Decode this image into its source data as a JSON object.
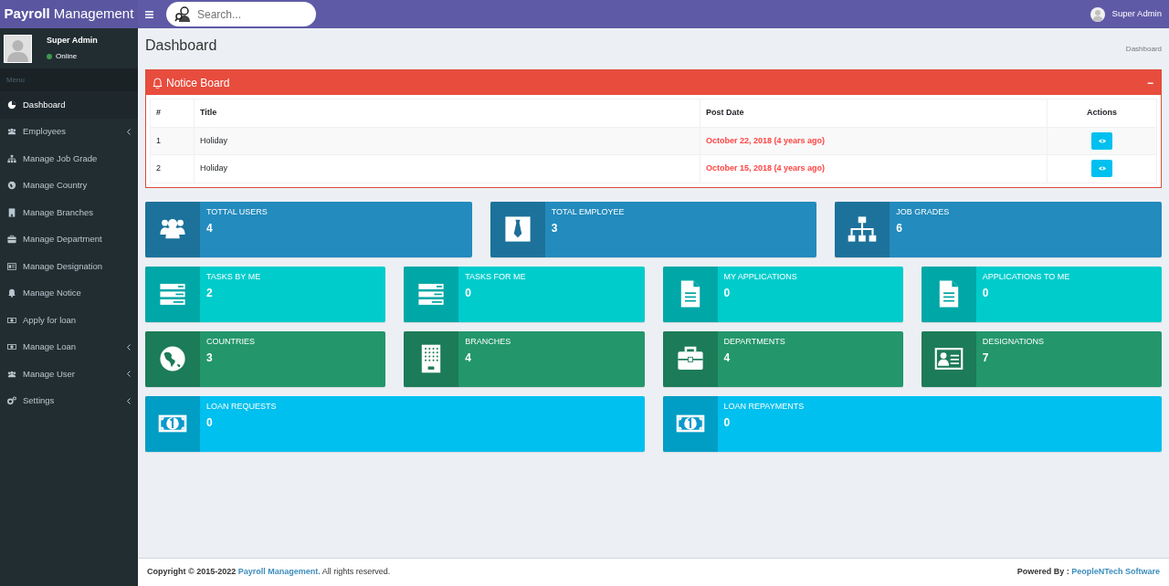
{
  "navbar": {
    "brand_bold": "Payroll",
    "brand_rest": "Management",
    "search": {
      "placeholder": "Search..."
    },
    "user": "Super Admin"
  },
  "sidebar": {
    "user": {
      "name": "Super Admin",
      "status": "Online"
    },
    "header": "Menu",
    "items": [
      {
        "label": "Dashboard",
        "selected": true,
        "expandable": false
      },
      {
        "label": "Employees",
        "selected": false,
        "expandable": true
      },
      {
        "label": "Manage Job Grade",
        "selected": false,
        "expandable": false
      },
      {
        "label": "Manage Country",
        "selected": false,
        "expandable": false
      },
      {
        "label": "Manage Branches",
        "selected": false,
        "expandable": false
      },
      {
        "label": "Manage Department",
        "selected": false,
        "expandable": false
      },
      {
        "label": "Manage Designation",
        "selected": false,
        "expandable": false
      },
      {
        "label": "Manage Notice",
        "selected": false,
        "expandable": false
      },
      {
        "label": "Apply for loan",
        "selected": false,
        "expandable": false
      },
      {
        "label": "Manage Loan",
        "selected": false,
        "expandable": true
      },
      {
        "label": "Manage User",
        "selected": false,
        "expandable": true
      },
      {
        "label": "Settings",
        "selected": false,
        "expandable": true
      }
    ]
  },
  "page": {
    "title": "Dashboard",
    "breadcrumb": "Dashboard"
  },
  "notice_board": {
    "title": "Notice Board",
    "collapse": "−",
    "columns": [
      "#",
      "Title",
      "Post Date",
      "Actions"
    ],
    "rows": [
      {
        "number": "1",
        "title": "Holiday",
        "post_date": "October 22, 2018 (4 years ago)"
      },
      {
        "number": "2",
        "title": "Holiday",
        "post_date": "October 15, 2018 (4 years ago)"
      }
    ]
  },
  "stat_rows": [
    [
      {
        "label": "TOTTAL USERS",
        "value": "4",
        "color": "#238bbd"
      },
      {
        "label": "TOTAL EMPLOYEE",
        "value": "3",
        "color": "#238bbd"
      },
      {
        "label": "JOB GRADES",
        "value": "6",
        "color": "#238bbd"
      }
    ],
    [
      {
        "label": "TASKS BY ME",
        "value": "2",
        "color": "#00cccc"
      },
      {
        "label": "TASKS FOR ME",
        "value": "0",
        "color": "#00cccc"
      },
      {
        "label": "MY APPLICATIONS",
        "value": "0",
        "color": "#00cccc"
      },
      {
        "label": "APPLICATIONS TO ME",
        "value": "0",
        "color": "#00cccc"
      }
    ],
    [
      {
        "label": "COUNTRIES",
        "value": "3",
        "color": "#23966c"
      },
      {
        "label": "BRANCHES",
        "value": "4",
        "color": "#23966c"
      },
      {
        "label": "DEPARTMENTS",
        "value": "4",
        "color": "#23966c"
      },
      {
        "label": "DESIGNATIONS",
        "value": "7",
        "color": "#23966c"
      }
    ],
    [
      {
        "label": "LOAN REQUESTS",
        "value": "0",
        "color": "#00c0ef"
      },
      {
        "label": "LOAN REPAYMENTS",
        "value": "0",
        "color": "#00c0ef"
      }
    ]
  ],
  "footer": {
    "copyright": "**Copyright © 2015-2022**",
    "link": "Payroll Management.",
    "rights": "All rights reserved.",
    "powered_by": "Powered By :",
    "company": "PeopleNTech Software"
  }
}
